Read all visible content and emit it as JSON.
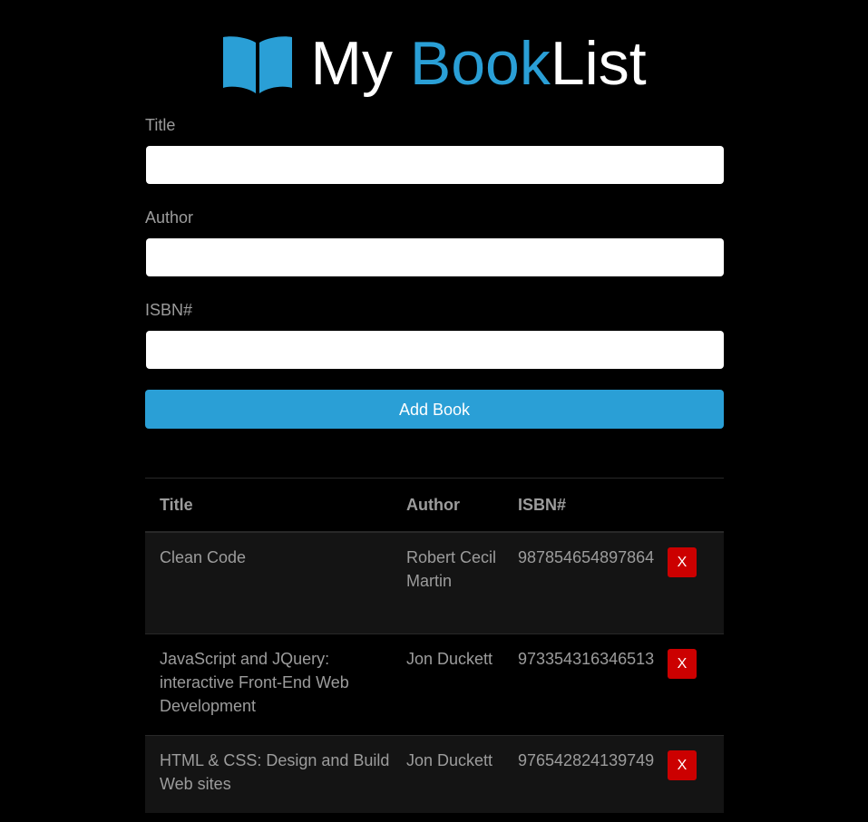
{
  "header": {
    "brand_part1": "My ",
    "brand_part2": "Book",
    "brand_part3": "List",
    "icon": "book-open-icon",
    "accent_color": "#2a9fd6"
  },
  "form": {
    "title_label": "Title",
    "title_value": "",
    "author_label": "Author",
    "author_value": "",
    "isbn_label": "ISBN#",
    "isbn_value": "",
    "submit_label": "Add Book"
  },
  "table": {
    "headers": [
      "Title",
      "Author",
      "ISBN#",
      ""
    ],
    "rows": [
      {
        "title": "Clean Code",
        "author": "Robert Cecil Martin",
        "isbn": "987854654897864",
        "delete_label": "X"
      },
      {
        "title": "JavaScript and JQuery: interactive Front-End Web Development",
        "author": "Jon Duckett",
        "isbn": "973354316346513",
        "delete_label": "X"
      },
      {
        "title": "HTML & CSS: Design and Build Web sites",
        "author": "Jon Duckett",
        "isbn": "976542824139749",
        "delete_label": "X"
      }
    ]
  },
  "colors": {
    "background": "#000000",
    "primary": "#2a9fd6",
    "danger": "#cc0000",
    "muted_text": "#9c9c9c"
  }
}
